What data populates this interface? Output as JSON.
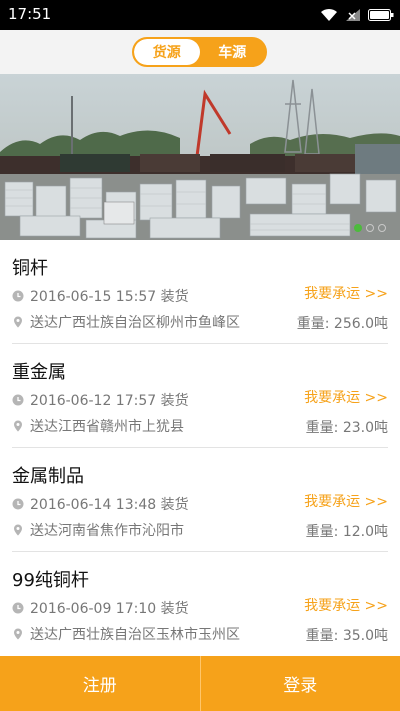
{
  "status_bar": {
    "time": "17:51"
  },
  "header": {
    "tabs": [
      {
        "label": "货源",
        "active": true
      },
      {
        "label": "车源",
        "active": false
      }
    ]
  },
  "banner": {
    "pager": {
      "count": 3,
      "active_index": 0
    }
  },
  "listings": [
    {
      "title": "铜杆",
      "load_time": "2016-06-15 15:57 装货",
      "destination": "送达广西壮族自治区柳州市鱼峰区",
      "action": "我要承运 >>",
      "weight": "重量: 256.0吨"
    },
    {
      "title": "重金属",
      "load_time": "2016-06-12 17:57 装货",
      "destination": "送达江西省赣州市上犹县",
      "action": "我要承运 >>",
      "weight": "重量: 23.0吨"
    },
    {
      "title": "金属制品",
      "load_time": "2016-06-14 13:48 装货",
      "destination": "送达河南省焦作市沁阳市",
      "action": "我要承运 >>",
      "weight": "重量: 12.0吨"
    },
    {
      "title": "99纯铜杆",
      "load_time": "2016-06-09 17:10 装货",
      "destination": "送达广西壮族自治区玉林市玉州区",
      "action": "我要承运 >>",
      "weight": "重量: 35.0吨"
    }
  ],
  "footer": {
    "register_label": "注册",
    "login_label": "登录"
  },
  "colors": {
    "accent": "#f6a21a",
    "pager_active": "#4cbb3c"
  }
}
